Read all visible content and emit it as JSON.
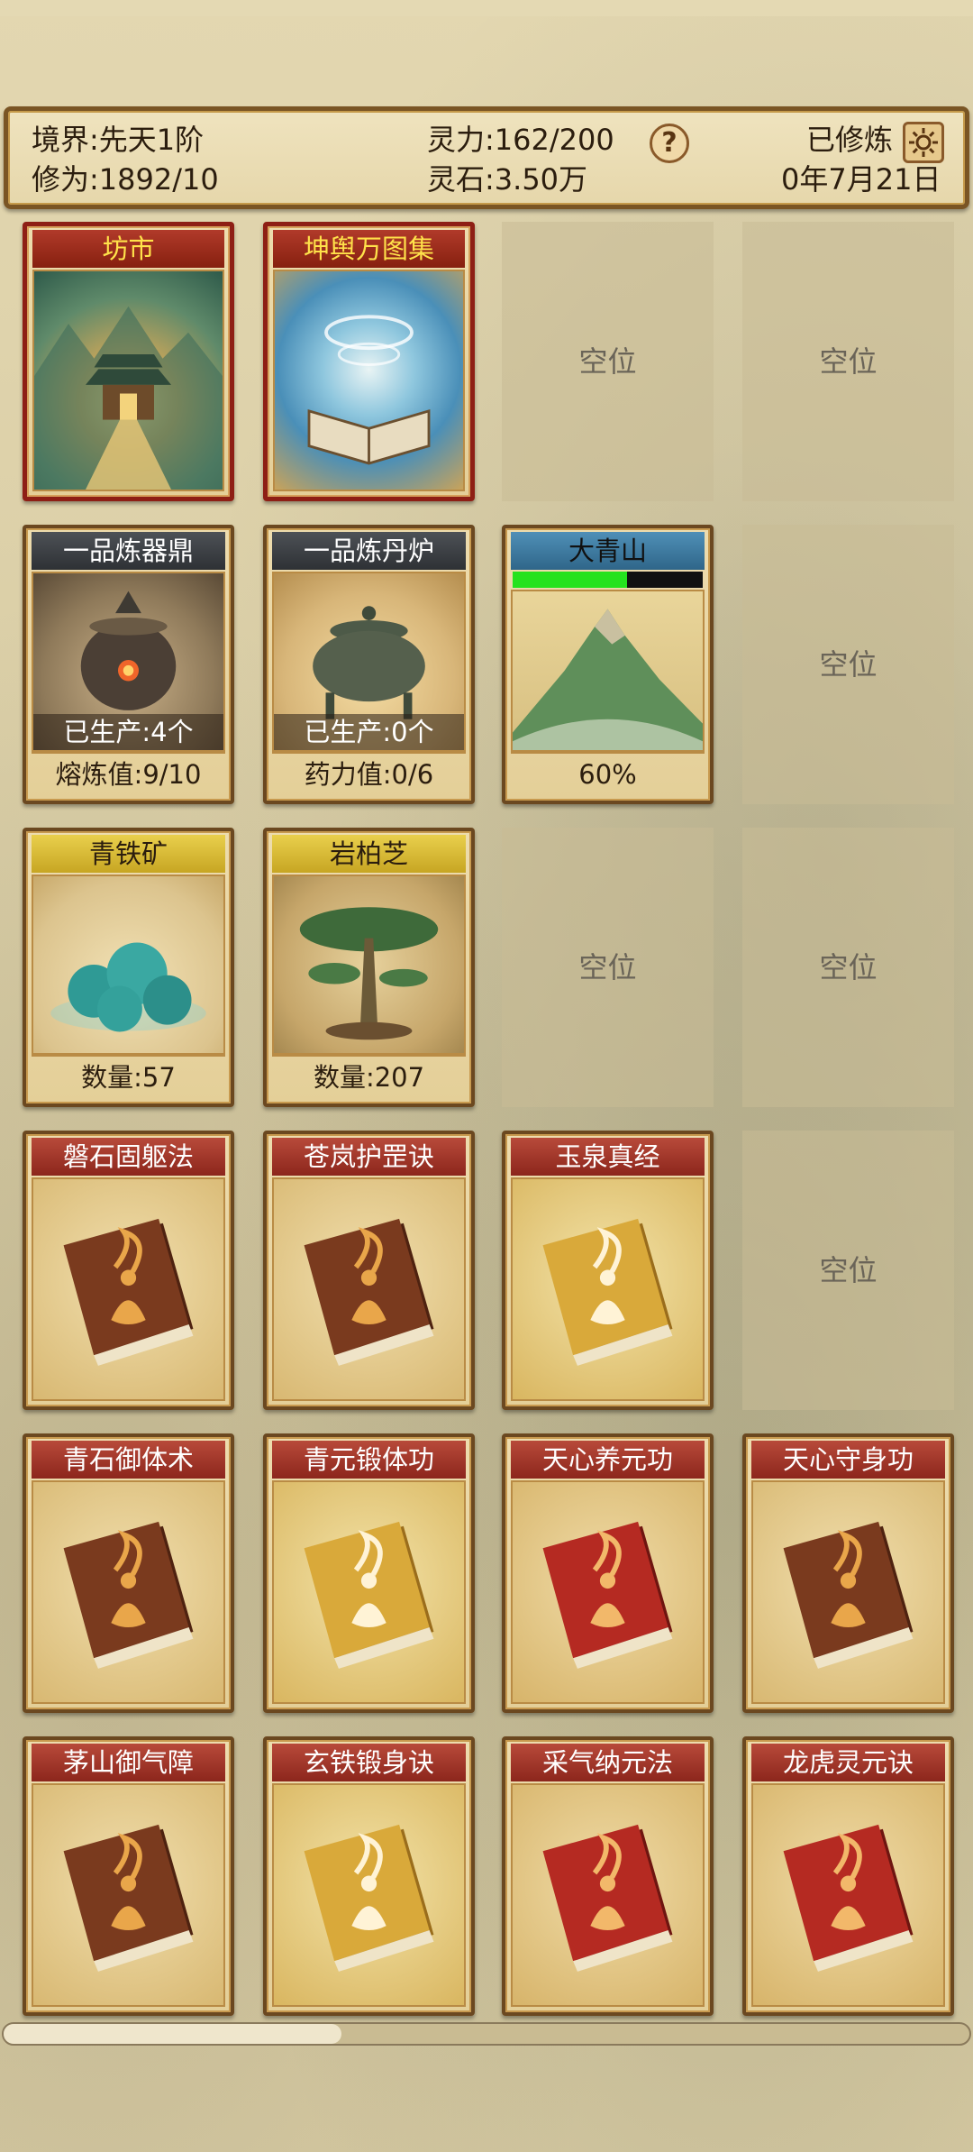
{
  "status": {
    "realm": "境界:先天1阶",
    "cultivation": "修为:1892/10",
    "spirit_power": "灵力:162/200",
    "spirit_stones": "灵石:3.50万",
    "help_label": "?",
    "state": "已修炼",
    "date": "0年7月21日"
  },
  "row1": {
    "market_title": "坊市",
    "atlas_title": "坤舆万图集"
  },
  "row2": {
    "forge_title": "一品炼器鼎",
    "forge_produced": "已生产:4个",
    "forge_value": "熔炼值:9/10",
    "furnace_title": "一品炼丹炉",
    "furnace_produced": "已生产:0个",
    "furnace_value": "药力值:0/6",
    "mountain_title": "大青山",
    "mountain_progress": 0.6,
    "mountain_percent": "60%"
  },
  "row3": {
    "ore_title": "青铁矿",
    "ore_count": "数量:57",
    "herb_title": "岩柏芝",
    "herb_count": "数量:207"
  },
  "empty_label": "空位",
  "books": [
    {
      "title": "磐石固躯法",
      "color": "brown"
    },
    {
      "title": "苍岚护罡诀",
      "color": "brown"
    },
    {
      "title": "玉泉真经",
      "color": "yellow"
    },
    {
      "title": "青石御体术",
      "color": "brown"
    },
    {
      "title": "青元锻体功",
      "color": "yellow"
    },
    {
      "title": "天心养元功",
      "color": "red"
    },
    {
      "title": "天心守身功",
      "color": "brown"
    },
    {
      "title": "茅山御气障",
      "color": "brown"
    },
    {
      "title": "玄铁锻身诀",
      "color": "yellow"
    },
    {
      "title": "采气纳元法",
      "color": "red"
    },
    {
      "title": "龙虎灵元诀",
      "color": "red"
    }
  ],
  "scroll": {
    "position": 0.35
  },
  "colors": {
    "background": "#d8cca4",
    "frame": "#6b4820",
    "title_red": "#8c261c",
    "title_gold": "#c7a623",
    "progress_green": "#25e21e"
  }
}
